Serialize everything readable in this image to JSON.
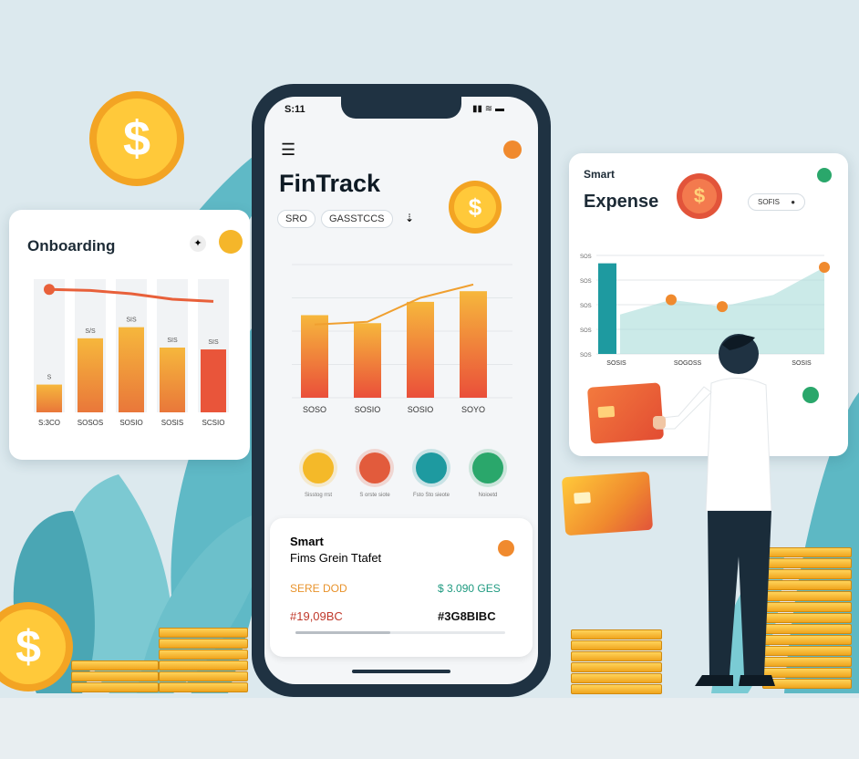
{
  "phone": {
    "status_time": "S:11",
    "app_title": "FinTrack",
    "pills": [
      "SRO",
      "GASSTCCS"
    ],
    "chart_data": {
      "type": "bar",
      "categories": [
        "SOSO",
        "SOSIO",
        "SOSIO",
        "SOYO"
      ],
      "values": [
        62,
        56,
        72,
        80
      ],
      "line": [
        55,
        57,
        75,
        85
      ],
      "ylim": [
        0,
        100
      ]
    },
    "actions": [
      {
        "label": "Sisstog rrst",
        "color": "#f4b929"
      },
      {
        "label": "S orste siote",
        "color": "#e25b3c"
      },
      {
        "label": "Fsto Sto sieote",
        "color": "#1e9aa0"
      },
      {
        "label": "Noioetd",
        "color": "#2aa76b"
      }
    ],
    "bottom_card": {
      "title": "Smart",
      "subtitle": "Fims Grein Ttafet",
      "left_amount": "SERE DOD",
      "right_amount": "$ 3.090 GES",
      "left_code": "#19,09BC",
      "right_code": "#3G8BIBC"
    }
  },
  "left_card": {
    "title": "Onboarding",
    "chart_data": {
      "type": "bar",
      "categories": [
        "S:3CO",
        "SOSOS",
        "SOSIO",
        "SOSIS",
        "SCSIO"
      ],
      "values": [
        30,
        80,
        92,
        70,
        68
      ],
      "labels": [
        "S",
        "S/S",
        "SIS",
        "SIS",
        "SIS"
      ],
      "line": [
        88,
        86,
        80,
        70,
        66
      ],
      "ylim": [
        0,
        140
      ]
    }
  },
  "right_card": {
    "title": "Smart",
    "subtitle": "Expense",
    "pill": "SOFIS",
    "chart_data": {
      "type": "area",
      "x_labels": [
        "SOSIS",
        "SOGOSS",
        "SOSIS"
      ],
      "bar_value": 92,
      "y_ticks": [
        "SOS",
        "SOS",
        "SOS",
        "SOS",
        "SOS"
      ],
      "points": [
        40,
        55,
        48,
        60,
        88
      ],
      "ylim": [
        0,
        100
      ]
    }
  },
  "colors": {
    "orange": "#f08a2e",
    "red": "#e2543a",
    "teal": "#1e9aa0",
    "navy": "#1f3242",
    "gold": "#f5b62a"
  }
}
